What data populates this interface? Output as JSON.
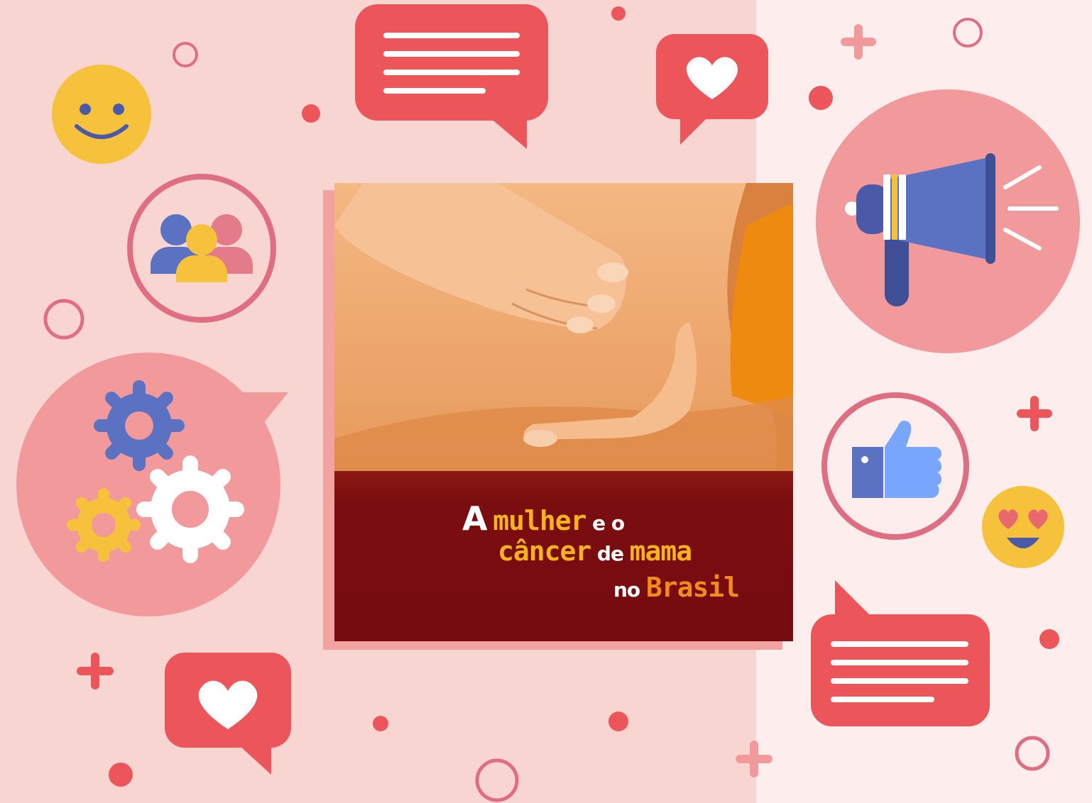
{
  "colors": {
    "background_left": "#f9d5d2",
    "background_right": "#fdeeed",
    "accent_red": "#ec555a",
    "accent_pink": "#f2999b",
    "accent_blue": "#5b72c2",
    "accent_yellow": "#f6c23b",
    "cover_band": "#760c10"
  },
  "cover": {
    "title_word_a": "A",
    "title_word_mulher": "mulher",
    "title_word_e_o": "e o",
    "title_word_cancer": "câncer",
    "title_word_de": "de",
    "title_word_mama": "mama",
    "title_word_no": "no",
    "title_word_brasil": "Brasil"
  },
  "icons": [
    "smiley-face-icon",
    "people-group-icon",
    "gears-icon",
    "heart-speech-bubble-icon",
    "text-speech-bubble-icon",
    "megaphone-icon",
    "thumbs-up-icon",
    "heart-eyes-emoji-icon",
    "plus-icon",
    "circle-outline-icon",
    "dot-icon"
  ]
}
